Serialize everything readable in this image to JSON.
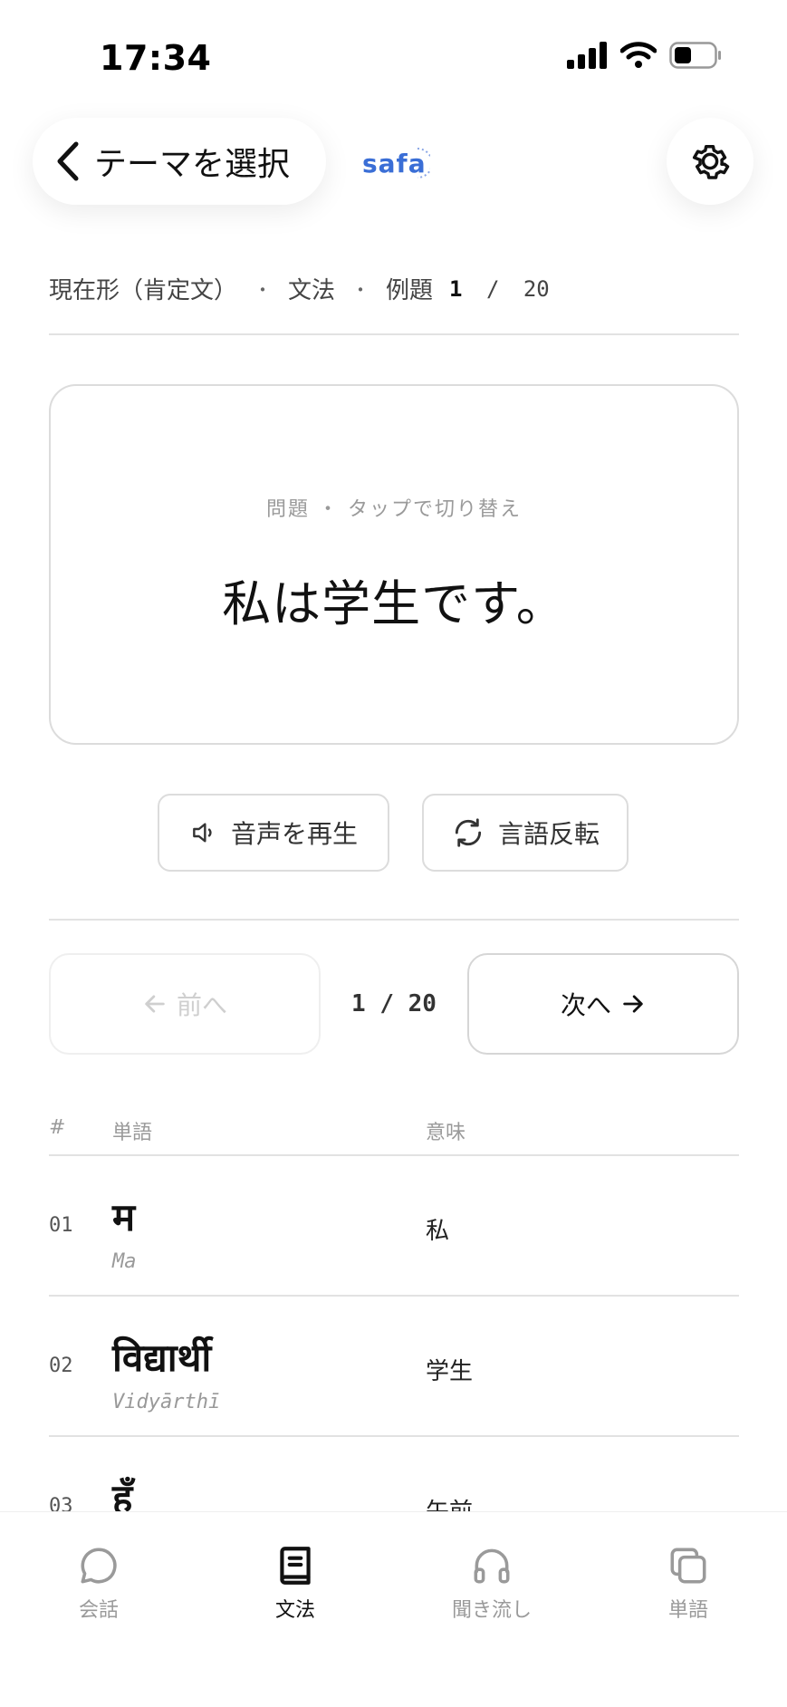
{
  "status_bar": {
    "time": "17:34"
  },
  "header": {
    "back_label": "テーマを選択",
    "brand": "safa",
    "brand_color": "#3a6ed6"
  },
  "breadcrumb": {
    "topic": "現在形（肯定文）",
    "section": "文法",
    "example_label": "例題",
    "current": "1",
    "separator": "/",
    "total": "20"
  },
  "card": {
    "hint": "問題 ・ タップで切り替え",
    "text": "私は学生です。"
  },
  "actions": {
    "play_audio": "音声を再生",
    "flip_language": "言語反転"
  },
  "navigation": {
    "prev_label": "前へ",
    "next_label": "次へ",
    "counter": "1 / 20"
  },
  "vocab_table": {
    "headers": {
      "num": "#",
      "word": "単語",
      "meaning": "意味"
    },
    "rows": [
      {
        "num": "01",
        "word": "म",
        "roman": "Ma",
        "meaning": "私"
      },
      {
        "num": "02",
        "word": "विद्यार्थी",
        "roman": "Vidyārthī",
        "meaning": "学生"
      },
      {
        "num": "03",
        "word": "हुँ",
        "roman": "",
        "meaning": "午前"
      }
    ]
  },
  "tab_bar": {
    "tabs": [
      {
        "label": "会話",
        "icon": "chat-bubble-icon",
        "active": false
      },
      {
        "label": "文法",
        "icon": "book-icon",
        "active": true
      },
      {
        "label": "聞き流し",
        "icon": "headphones-icon",
        "active": false
      },
      {
        "label": "単語",
        "icon": "cards-icon",
        "active": false
      }
    ]
  }
}
